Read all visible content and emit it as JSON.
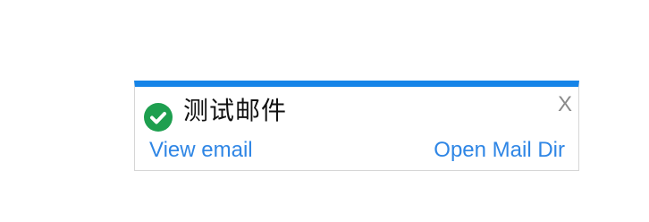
{
  "notification": {
    "title": "测试邮件",
    "close_label": "X",
    "view_email_label": "View email",
    "open_mail_dir_label": "Open Mail Dir",
    "status_icon": "check-circle-icon",
    "colors": {
      "accent": "#1584e8",
      "success": "#1e9f4f",
      "link": "#2f86e5",
      "close": "#8a8a8a"
    }
  }
}
